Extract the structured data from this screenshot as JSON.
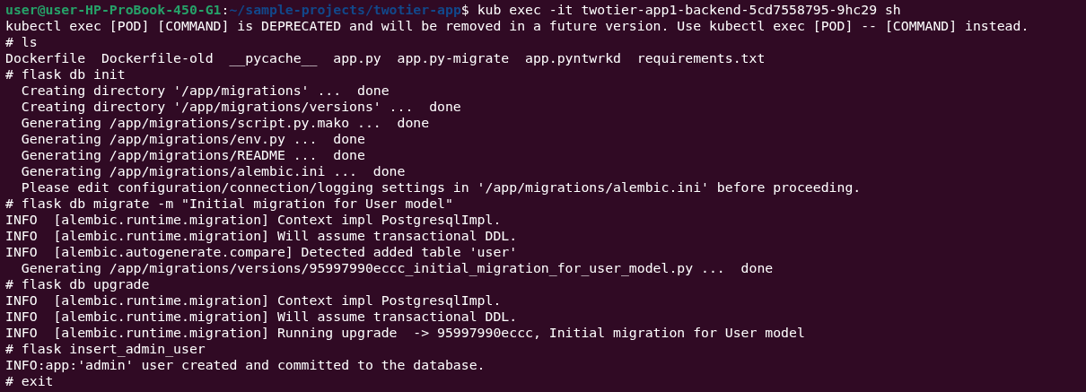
{
  "terminal": {
    "lines": [
      {
        "kind": "prompt",
        "user_host": "user@user-HP-ProBook-450-G1",
        "separator": ":",
        "path": "~/sample-projects/twotier-app",
        "command": "$ kub exec -it twotier-app1-backend-5cd7558795-9hc29 sh"
      },
      {
        "kind": "output",
        "text": "kubectl exec [POD] [COMMAND] is DEPRECATED and will be removed in a future version. Use kubectl exec [POD] -- [COMMAND] instead."
      },
      {
        "kind": "output",
        "text": "# ls"
      },
      {
        "kind": "output",
        "text": "Dockerfile  Dockerfile-old  __pycache__  app.py  app.py-migrate  app.pyntwrkd  requirements.txt"
      },
      {
        "kind": "output",
        "text": "# flask db init"
      },
      {
        "kind": "output",
        "text": "  Creating directory '/app/migrations' ...  done"
      },
      {
        "kind": "output",
        "text": "  Creating directory '/app/migrations/versions' ...  done"
      },
      {
        "kind": "output",
        "text": "  Generating /app/migrations/script.py.mako ...  done"
      },
      {
        "kind": "output",
        "text": "  Generating /app/migrations/env.py ...  done"
      },
      {
        "kind": "output",
        "text": "  Generating /app/migrations/README ...  done"
      },
      {
        "kind": "output",
        "text": "  Generating /app/migrations/alembic.ini ...  done"
      },
      {
        "kind": "output",
        "text": "  Please edit configuration/connection/logging settings in '/app/migrations/alembic.ini' before proceeding."
      },
      {
        "kind": "output",
        "text": "# flask db migrate -m \"Initial migration for User model\""
      },
      {
        "kind": "output",
        "text": "INFO  [alembic.runtime.migration] Context impl PostgresqlImpl."
      },
      {
        "kind": "output",
        "text": "INFO  [alembic.runtime.migration] Will assume transactional DDL."
      },
      {
        "kind": "output",
        "text": "INFO  [alembic.autogenerate.compare] Detected added table 'user'"
      },
      {
        "kind": "output",
        "text": "  Generating /app/migrations/versions/95997990eccc_initial_migration_for_user_model.py ...  done"
      },
      {
        "kind": "output",
        "text": "# flask db upgrade"
      },
      {
        "kind": "output",
        "text": "INFO  [alembic.runtime.migration] Context impl PostgresqlImpl."
      },
      {
        "kind": "output",
        "text": "INFO  [alembic.runtime.migration] Will assume transactional DDL."
      },
      {
        "kind": "output",
        "text": "INFO  [alembic.runtime.migration] Running upgrade  -> 95997990eccc, Initial migration for User model"
      },
      {
        "kind": "output",
        "text": "# flask insert_admin_user"
      },
      {
        "kind": "output",
        "text": "INFO:app:'admin' user created and committed to the database."
      },
      {
        "kind": "output",
        "text": "# exit"
      }
    ]
  }
}
